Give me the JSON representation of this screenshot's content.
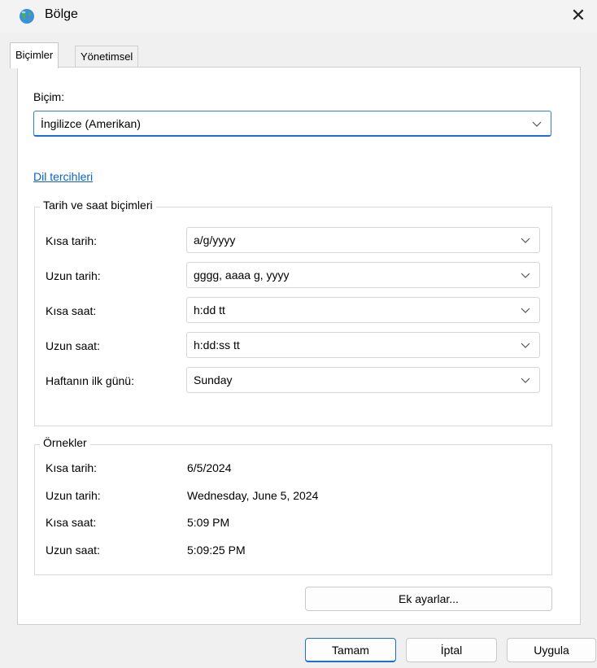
{
  "window": {
    "title": "Bölge",
    "icon": "globe-icon"
  },
  "tabs": [
    {
      "label": "Biçimler",
      "active": true
    },
    {
      "label": "Yönetimsel",
      "active": false
    }
  ],
  "format": {
    "label": "Biçim:",
    "value": "İngilizce (Amerikan)"
  },
  "language_link": "Dil tercihleri",
  "datetime_group": {
    "title": "Tarih ve saat biçimleri",
    "rows": [
      {
        "label": "Kısa tarih:",
        "value": "a/g/yyyy"
      },
      {
        "label": "Uzun tarih:",
        "value": "gggg, aaaa g, yyyy"
      },
      {
        "label": "Kısa saat:",
        "value": "h:dd tt"
      },
      {
        "label": "Uzun saat:",
        "value": "h:dd:ss tt"
      },
      {
        "label": "Haftanın ilk günü:",
        "value": "Sunday"
      }
    ]
  },
  "examples": {
    "title": "Örnekler",
    "rows": [
      {
        "label": "Kısa tarih:",
        "value": "6/5/2024"
      },
      {
        "label": "Uzun tarih:",
        "value": "Wednesday, June 5, 2024"
      },
      {
        "label": "Kısa saat:",
        "value": "5:09 PM"
      },
      {
        "label": "Uzun saat:",
        "value": "5:09:25 PM"
      }
    ]
  },
  "buttons": {
    "additional": "Ek ayarlar...",
    "ok": "Tamam",
    "cancel": "İptal",
    "apply": "Uygula"
  },
  "colors": {
    "accent": "#1e6fd0",
    "link": "#0b63c4"
  }
}
